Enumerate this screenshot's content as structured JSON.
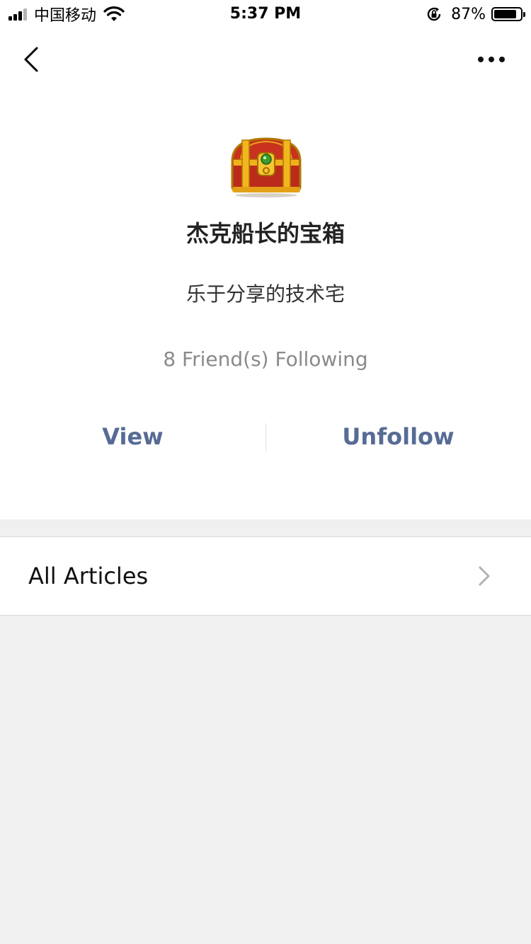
{
  "status_bar": {
    "carrier": "中国移动",
    "time": "5:37 PM",
    "battery_percent": "87%",
    "battery_level": 0.87,
    "icons": [
      "signal-icon",
      "wifi-icon",
      "rotation-lock-icon",
      "battery-icon"
    ]
  },
  "nav": {
    "back_icon": "chevron-left-icon",
    "more_icon": "more-dots-icon"
  },
  "profile": {
    "avatar_icon": "treasure-chest-icon",
    "name": "杰克船长的宝箱",
    "description": "乐于分享的技术宅",
    "friends_following": "8 Friend(s) Following"
  },
  "actions": {
    "view_label": "View",
    "unfollow_label": "Unfollow"
  },
  "articles": {
    "label": "All Articles",
    "chevron_icon": "chevron-right-icon"
  },
  "colors": {
    "link": "#576b95",
    "page_bg": "#f0f0f0",
    "card_bg": "#ffffff",
    "muted_text": "#8a8a8a"
  }
}
